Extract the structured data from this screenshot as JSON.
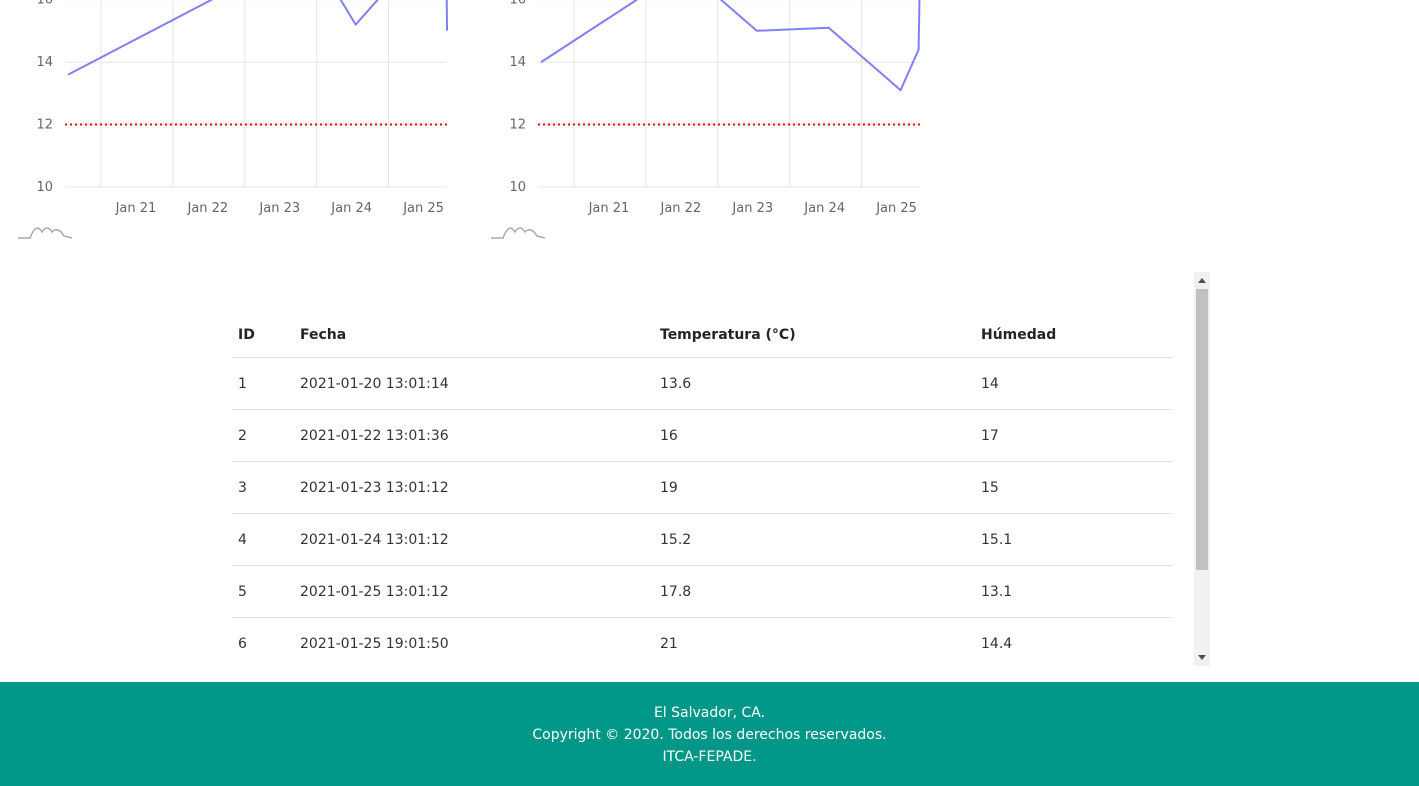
{
  "chart_data": [
    {
      "type": "line",
      "x": [
        "2021-01-20 13:01:14",
        "2021-01-22 13:01:36",
        "2021-01-23 13:01:12",
        "2021-01-24 13:01:12",
        "2021-01-25 13:01:12",
        "2021-01-25 19:01:50",
        "2021-01-25 19:30:00"
      ],
      "series": [
        {
          "values": [
            13.6,
            16,
            19,
            15.2,
            17.8,
            21,
            15
          ]
        }
      ],
      "threshold": 12,
      "x_ticks": [
        "Jan 21",
        "Jan 22",
        "Jan 23",
        "Jan 24",
        "Jan 25"
      ],
      "y_ticks": [
        10,
        12,
        14,
        16
      ],
      "xlim": [
        "2021-01-20 12:00",
        "2021-01-25 19:30"
      ],
      "ylim": [
        10,
        16.5
      ],
      "colors": {
        "line": "#8080f0",
        "threshold": "#ff0000",
        "grid": "#e5e5e5"
      }
    },
    {
      "type": "line",
      "x": [
        "2021-01-20 13:01:14",
        "2021-01-22 13:01:36",
        "2021-01-23 13:01:12",
        "2021-01-24 13:01:12",
        "2021-01-25 13:01:12",
        "2021-01-25 19:01:50",
        "2021-01-25 19:30:00"
      ],
      "series": [
        {
          "values": [
            14,
            17,
            15,
            15.1,
            13.1,
            14.4,
            17
          ]
        }
      ],
      "threshold": 12,
      "x_ticks": [
        "Jan 21",
        "Jan 22",
        "Jan 23",
        "Jan 24",
        "Jan 25"
      ],
      "y_ticks": [
        10,
        12,
        14,
        16
      ],
      "xlim": [
        "2021-01-20 12:00",
        "2021-01-25 19:30"
      ],
      "ylim": [
        10,
        16.5
      ],
      "colors": {
        "line": "#8080f0",
        "threshold": "#ff0000",
        "grid": "#e5e5e5"
      }
    }
  ],
  "table": {
    "headers": [
      "ID",
      "Fecha",
      "Temperatura (°C)",
      "Húmedad"
    ],
    "rows": [
      [
        "1",
        "2021-01-20 13:01:14",
        "13.6",
        "14"
      ],
      [
        "2",
        "2021-01-22 13:01:36",
        "16",
        "17"
      ],
      [
        "3",
        "2021-01-23 13:01:12",
        "19",
        "15"
      ],
      [
        "4",
        "2021-01-24 13:01:12",
        "15.2",
        "15.1"
      ],
      [
        "5",
        "2021-01-25 13:01:12",
        "17.8",
        "13.1"
      ],
      [
        "6",
        "2021-01-25 19:01:50",
        "21",
        "14.4"
      ]
    ]
  },
  "footer": {
    "line1": "El Salvador, CA.",
    "line2": "Copyright © 2020. Todos los derechos reservados.",
    "line3": "ITCA-FEPADE."
  },
  "colors": {
    "footer_bg": "#009688"
  }
}
